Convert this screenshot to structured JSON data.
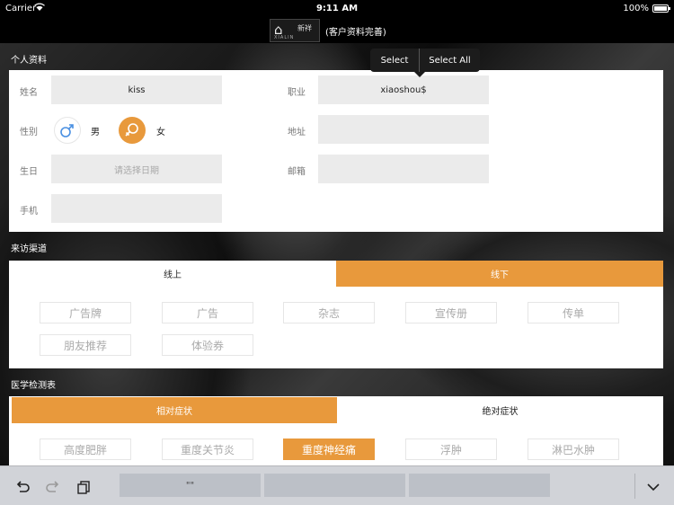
{
  "status_bar": {
    "carrier": "Carrier",
    "time": "9:11 AM",
    "battery": "100%",
    "battery_level": 1.0
  },
  "nav": {
    "logo_text": "新祥",
    "logo_small": "XIALIN",
    "title": "(客户资料完善)"
  },
  "context_menu": {
    "select": "Select",
    "select_all": "Select All"
  },
  "personal": {
    "section_title": "个人资料",
    "name_label": "姓名",
    "name_value": "kiss",
    "job_label": "职业",
    "job_value": "xiaoshou$",
    "gender_label": "性别",
    "male": "男",
    "female": "女",
    "selected_gender": "女",
    "address_label": "地址",
    "address_value": "",
    "birthday_label": "生日",
    "birthday_placeholder": "请选择日期",
    "email_label": "邮箱",
    "email_value": "",
    "phone_label": "手机",
    "phone_value": ""
  },
  "channel": {
    "section_title": "来访渠道",
    "tabs": [
      {
        "label": "线上",
        "active": false
      },
      {
        "label": "线下",
        "active": true
      }
    ],
    "chips": [
      "广告牌",
      "广告",
      "杂志",
      "宣传册",
      "传单",
      "朋友推荐",
      "体验券"
    ]
  },
  "medical": {
    "section_title": "医学检测表",
    "tabs": [
      {
        "label": "相对症状",
        "active": true
      },
      {
        "label": "绝对症状",
        "active": false
      }
    ],
    "chips": [
      "高度肥胖",
      "重度关节炎",
      "重度神经痛",
      "浮肿",
      "淋巴水肿"
    ],
    "selected": "重度神经痛"
  },
  "keyboard": {
    "suggestion_1": "\"\"",
    "suggestion_2": "",
    "suggestion_3": ""
  },
  "colors": {
    "accent": "#e8993c",
    "field_bg": "#ebebeb"
  }
}
